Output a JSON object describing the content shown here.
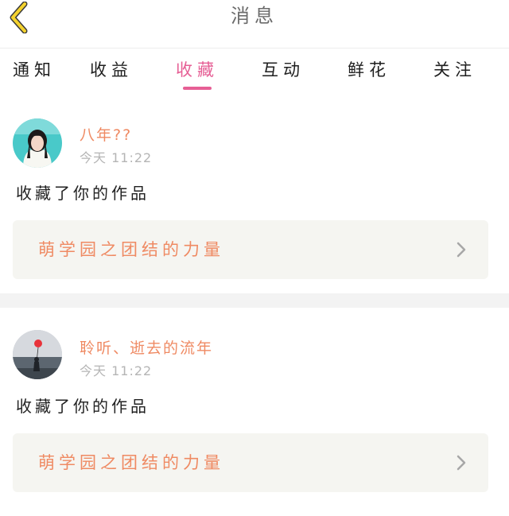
{
  "header": {
    "title": "消息",
    "back_icon": "chevron-left-icon",
    "back_color": "#f4d22d"
  },
  "tabs": [
    {
      "label": "通知",
      "active": false
    },
    {
      "label": "收益",
      "active": false
    },
    {
      "label": "收藏",
      "active": true
    },
    {
      "label": "互动",
      "active": false
    },
    {
      "label": "鲜花",
      "active": false
    },
    {
      "label": "关注",
      "active": false
    }
  ],
  "accent_color": "#e65f95",
  "name_color": "#ef8a63",
  "messages": [
    {
      "username": "八年??",
      "time": "今天 11:22",
      "action": "收藏了你的作品",
      "work_title": "萌学园之团结的力量",
      "chevron_icon": "chevron-right-icon",
      "avatar_icon": "avatar-girl-icon"
    },
    {
      "username": "聆听、逝去的流年",
      "time": "今天 11:22",
      "action": "收藏了你的作品",
      "work_title": "萌学园之团结的力量",
      "chevron_icon": "chevron-right-icon",
      "avatar_icon": "avatar-balloon-icon"
    }
  ]
}
